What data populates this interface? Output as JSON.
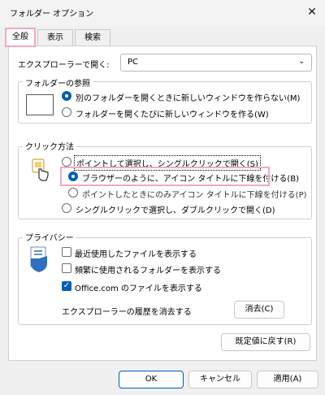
{
  "window": {
    "title": "フォルダー オプション"
  },
  "tabs": [
    "全般",
    "表示",
    "検索"
  ],
  "open_explorer": {
    "label": "エクスプローラーで開く:",
    "value": "PC"
  },
  "browse": {
    "title": "フォルダーの参照",
    "options": [
      "別のフォルダーを開くときに新しいウィンドウを作らない(M)",
      "フォルダーを開くたびに新しいウィンドウを作る(W)"
    ]
  },
  "click": {
    "title": "クリック方法",
    "options": [
      "ポイントして選択し、シングルクリックで開く(S)",
      "ブラウザーのように、アイコン タイトルに下線を付ける(B)",
      "ポイントしたときにのみアイコン タイトルに下線を付ける(P)",
      "シングルクリックで選択し、ダブルクリックで開く(D)"
    ]
  },
  "privacy": {
    "title": "プライバシー",
    "checks": [
      "最近使用したファイルを表示する",
      "頻繁に使用されるフォルダーを表示する",
      "Office.com のファイルを表示する"
    ],
    "history_label": "エクスプローラーの履歴を消去する",
    "clear_button": "消去(C)"
  },
  "restore_button": "既定値に戻す(R)",
  "footer": {
    "ok": "OK",
    "cancel": "キャンセル",
    "apply": "適用(A)"
  }
}
